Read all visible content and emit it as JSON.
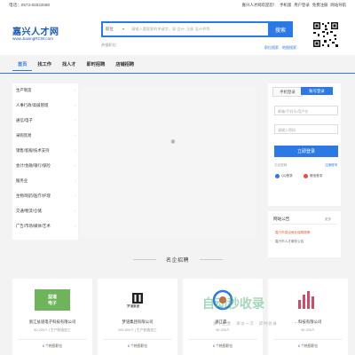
{
  "topbar": {
    "phone": "电话：0573-82822588",
    "links": [
      "嘉兴人才网欢迎您！",
      "手机版",
      "用户登录",
      "免费注册",
      "网站导航"
    ]
  },
  "header": {
    "logo_main": "嘉兴人才网",
    "logo_sub": "www.JiaxingRCW.com",
    "search": {
      "type": "职位",
      "placeholder": "请输入要搜索的关键字，如 会计, 注册 设计师等",
      "button": "搜索",
      "hot_label": "热搜职位："
    },
    "hot_links": [
      "职位搜索",
      "地图搜索"
    ]
  },
  "nav": {
    "items": [
      "首页",
      "找工作",
      "找人才",
      "即时招聘",
      "店铺招聘"
    ]
  },
  "categories": [
    "生产制造",
    "人事行政/高级管理",
    "通信/电子",
    "采购贸易",
    "销售/客服/技术支持",
    "会计/金融/银行/保险",
    "服务业",
    "生物/制药/医疗/护理",
    "交通/物流/仓储",
    "广告/市场/媒体/艺术"
  ],
  "login": {
    "tab_phone": "手机登录",
    "tab_account": "账号登录",
    "account_placeholder": "邮箱/手机号/用户名",
    "password_placeholder": "请输入密码",
    "button": "立即登录",
    "forgot": "忘记密码",
    "register": "注册账号",
    "qq": "QQ登录",
    "wechat": "微信登录"
  },
  "notice": {
    "title": "网站公告",
    "more": "更多",
    "items": [
      "嘉兴市突出就业保障政策",
      "嘉兴市人才服务公告"
    ]
  },
  "section": {
    "title": "名企招聘"
  },
  "companies": [
    {
      "name": "浙江益道电子科技有限公司",
      "logo_text": "益道\n电子",
      "meta": "50-200人 | 生产制造加工",
      "jobs": "6",
      "jobs_suffix": "个热招职位"
    },
    {
      "name": "梦道集团有限公司",
      "logo_text": "梦道集团",
      "meta": "200-500人 | 生产制造加工",
      "jobs": "6",
      "jobs_suffix": "个热招职位"
    },
    {
      "name": "浙江晨…",
      "logo_text": "",
      "meta": "50-200人",
      "jobs": "6",
      "jobs_suffix": "个热招职位"
    },
    {
      "name": "…科技有限公司",
      "logo_text": "",
      "meta": "50-200人",
      "jobs": "6",
      "jobs_suffix": "个热招职位"
    }
  ],
  "watermark": {
    "main": "自动秒收录",
    "sub": "源于主流 · 来访一次 · 即时收录"
  },
  "colors": {
    "primary": "#2b79e5",
    "logo": "#1a5ab9"
  }
}
